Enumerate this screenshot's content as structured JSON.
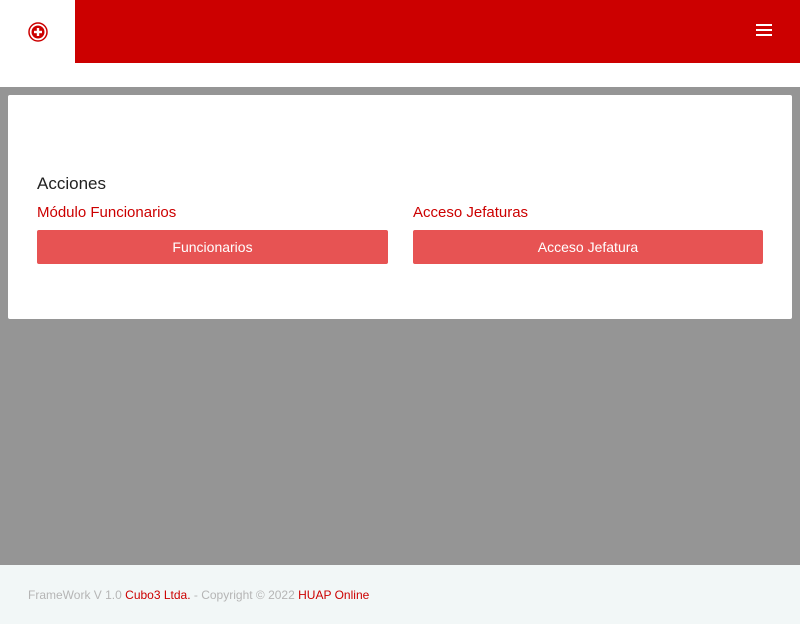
{
  "header": {
    "logo_icon": "institution-seal-icon",
    "menu_icon": "hamburger-menu-icon",
    "brand_color": "#cc0000"
  },
  "main": {
    "section_title": "Acciones",
    "modules": [
      {
        "title": "Módulo Funcionarios",
        "button_label": "Funcionarios"
      },
      {
        "title": "Acceso Jefaturas",
        "button_label": "Acceso Jefatura"
      }
    ],
    "button_color": "#e75353"
  },
  "footer": {
    "prefix": "FrameWork V 1.0",
    "company_link": "Cubo3 Ltda.",
    "copyright": "- Copyright © 2022",
    "site_link": "HUAP Online"
  }
}
